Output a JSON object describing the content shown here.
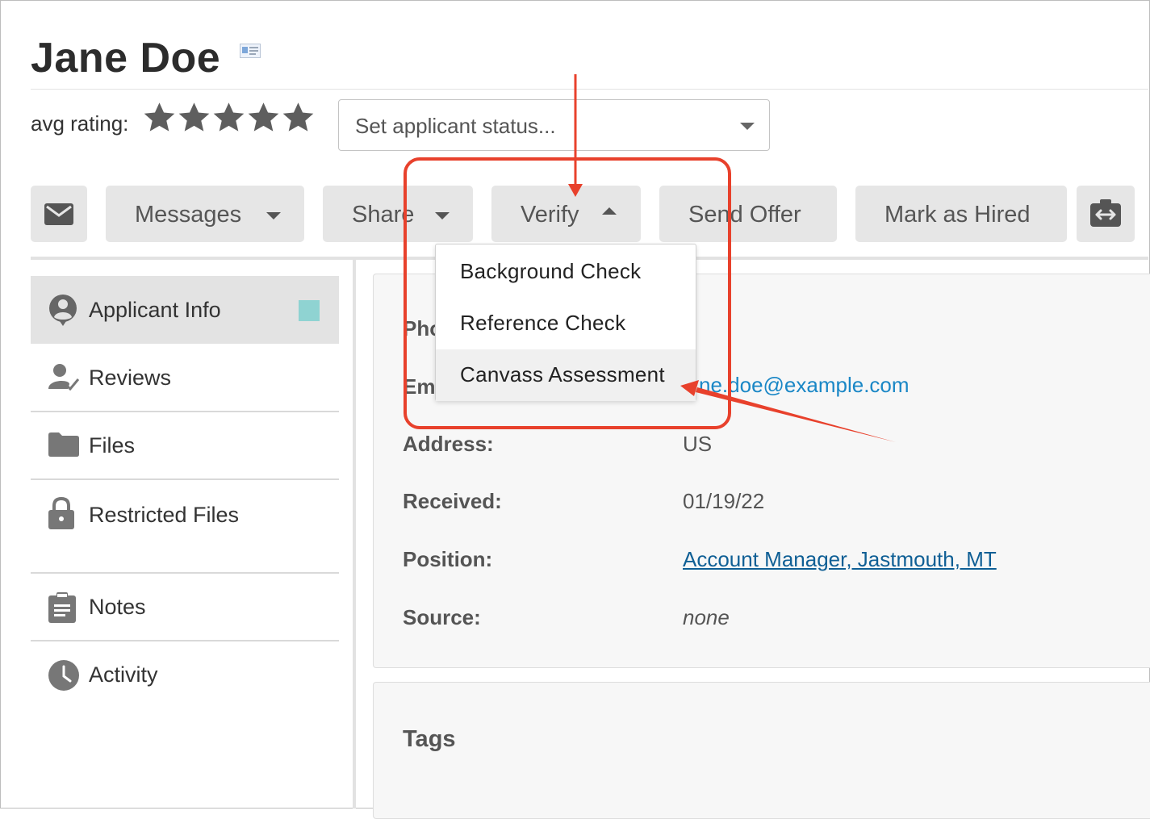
{
  "header": {
    "applicant_name": "Jane Doe",
    "rating_label": "avg rating:",
    "star_count": 5,
    "status_placeholder": "Set applicant status..."
  },
  "toolbar": {
    "email_icon": "envelope-icon",
    "messages_label": "Messages",
    "share_label": "Share",
    "verify_label": "Verify",
    "send_offer_label": "Send Offer",
    "mark_hired_label": "Mark as Hired",
    "transfer_icon": "transfer-icon"
  },
  "verify_menu": {
    "items": [
      "Background Check",
      "Reference Check",
      "Canvass Assessment"
    ],
    "highlighted": "Canvass Assessment"
  },
  "sidebar": {
    "items": [
      {
        "label": "Applicant Info",
        "icon": "user-circle-icon"
      },
      {
        "label": "Reviews",
        "icon": "user-check-icon"
      },
      {
        "label": "Files",
        "icon": "folder-icon"
      },
      {
        "label": "Restricted Files",
        "icon": "lock-icon"
      },
      {
        "label": "Notes",
        "icon": "clipboard-icon"
      },
      {
        "label": "Activity",
        "icon": "clock-icon"
      }
    ]
  },
  "details": {
    "phone_label_partial": "Pho",
    "email_label_partial": "Em",
    "email_value_partial": "ne.doe@example.com",
    "address_label": "Address:",
    "address_value": "US",
    "received_label": "Received:",
    "received_value": "01/19/22",
    "position_label": "Position:",
    "position_value": "Account Manager, Jastmouth, MT",
    "source_label": "Source:",
    "source_value": "none"
  },
  "tags": {
    "title": "Tags"
  },
  "colors": {
    "annotation_red": "#e8412c",
    "accent_teal": "#8fd3d2",
    "link_blue": "#1a87c6"
  }
}
